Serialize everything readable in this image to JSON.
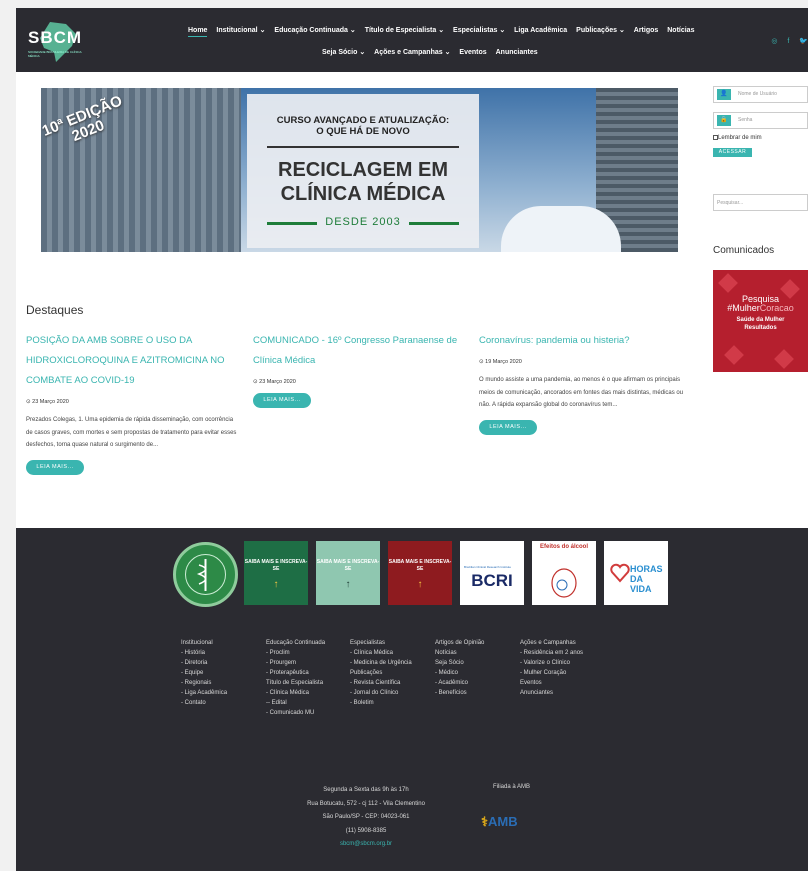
{
  "header": {
    "logo_text": "SBCM",
    "logo_subtext": "SOCIEDADE BRASILEIRA DE CLÍNICA MÉDICA",
    "nav_row1": [
      {
        "label": "Home",
        "active": true
      },
      {
        "label": "Institucional ⌄"
      },
      {
        "label": "Educação Continuada ⌄"
      },
      {
        "label": "Título de Especialista ⌄"
      },
      {
        "label": "Especialistas ⌄"
      },
      {
        "label": "Liga Acadêmica"
      },
      {
        "label": "Publicações ⌄"
      },
      {
        "label": "Artigos"
      },
      {
        "label": "Notícias"
      }
    ],
    "nav_row2": [
      {
        "label": "Seja Sócio ⌄"
      },
      {
        "label": "Ações e Campanhas ⌄"
      },
      {
        "label": "Eventos"
      },
      {
        "label": "Anunciantes"
      }
    ],
    "social": [
      "◎",
      "f",
      "🐦"
    ]
  },
  "banner": {
    "edition": "10ª EDIÇÃO",
    "year": "2020",
    "line1": "CURSO AVANÇADO E ATUALIZAÇÃO:",
    "line2": "O QUE HÁ DE NOVO",
    "title1": "RECICLAGEM EM",
    "title2": "CLÍNICA MÉDICA",
    "since": "DESDE 2003"
  },
  "sidebar": {
    "username_placeholder": "Nome de Usuário",
    "password_placeholder": "Senha",
    "remember_label": "Lembrar de mim",
    "login_button": "ACESSAR",
    "search_placeholder": "Pesquisar...",
    "comunicados_title": "Comunicados",
    "campaign_title1": "Pesquisa",
    "campaign_title2a": "#Mulher",
    "campaign_title2b": "Coracao",
    "campaign_subtitle1": "Saúde da Mulher",
    "campaign_subtitle2": "Resultados"
  },
  "destaques": {
    "title": "Destaques",
    "posts": [
      {
        "title": "POSIÇÃO DA AMB SOBRE O USO DA HIDROXICLOROQUINA E AZITROMICINA NO COMBATE AO COVID-19",
        "date": "⊙ 23 Março 2020",
        "excerpt": "Prezados Colegas, 1. Uma epidemia de rápida disseminação, com ocorrência de casos graves, com mortes e sem propostas de tratamento para evitar esses desfechos, torna quase natural o surgimento de...",
        "button": "LEIA MAIS..."
      },
      {
        "title": "COMUNICADO - 16º Congresso Paranaense de Clínica Médica",
        "date": "⊙ 23 Março 2020",
        "excerpt": "",
        "button": "LEIA MAIS..."
      },
      {
        "title": "Coronavírus: pandemia ou histeria?",
        "date": "⊙ 19 Março 2020",
        "excerpt": "O mundo assiste a uma pandemia, ao menos é o que afirmam os principais meios de comunicação, ancorados em fontes das mais distintas, médicas ou não. A rápida expansão global do coronavírus tem...",
        "button": "LEIA MAIS..."
      }
    ]
  },
  "partners": {
    "box1": "SAIBA MAIS E INSCREVA-SE",
    "box2": "SAIBA MAIS E INSCREVA-SE",
    "box3": "SAIBA MAIS E INSCREVA-SE",
    "arrow": "↑",
    "bcri_text": "BCRI",
    "bcri_sub": "Brazilian Clinical Research Institute",
    "alcool_title": "Efeitos do álcool",
    "horas_text": "HORAS DA VIDA",
    "colors": {
      "green": "#1e6e45",
      "mint": "#8fc7b0",
      "red": "#8e1b1f"
    }
  },
  "footer": {
    "columns": [
      [
        "Institucional",
        "- História",
        "- Diretoria",
        "- Equipe",
        "- Regionais",
        "- Liga Acadêmica",
        "- Contato"
      ],
      [
        "Educação Continuada",
        "- Proclim",
        "- Prourgem",
        "- Proterapêutica",
        "Título de Especialista",
        "- Clínica Médica",
        "-- Edital",
        "- Comunicado MU"
      ],
      [
        "Especialistas",
        "- Clínica Médica",
        "- Medicina de Urgência",
        "Publicações",
        "- Revista Científica",
        "- Jornal do Clínico",
        "- Boletim"
      ],
      [
        "Artigos de Opinião",
        "Notícias",
        "Seja Sócio",
        "- Médico",
        "- Acadêmico",
        "- Benefícios"
      ],
      [
        "Ações e Campanhas",
        "- Residência em 2 anos",
        "- Valorize o Clínico",
        "- Mulher Coração",
        "Eventos",
        "Anunciantes"
      ]
    ],
    "hours": "Segunda a Sexta das 9h às 17h",
    "address1": "Rua Botucatu, 572 - cj 112 - Vila Clementino",
    "address2": "São Paulo/SP - CEP: 04023-061",
    "phone": "(11) 5908-8385",
    "email": "sbcm@sbcm.org.br",
    "filiada": "Filiada à AMB",
    "amb_logo": "AMB",
    "amb_symbol": "⚕"
  },
  "colors": {
    "accent": "#3ab5b0",
    "dark": "#2b2b31",
    "red": "#b51f2e"
  }
}
